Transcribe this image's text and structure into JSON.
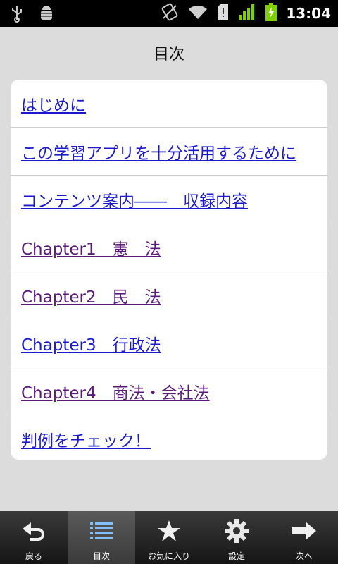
{
  "status_bar": {
    "time": "13:04",
    "icons_left": [
      "usb-icon",
      "android-debug-icon"
    ],
    "icons_right": [
      "no-sim-vibrate-icon",
      "wifi-icon",
      "sd-card-icon",
      "signal-icon",
      "battery-charging-icon"
    ]
  },
  "header": {
    "title": "目次"
  },
  "toc": {
    "items": [
      {
        "label": "はじめに",
        "visited": false
      },
      {
        "label": "この学習アプリを十分活用するために",
        "visited": false
      },
      {
        "label": "コンテンツ案内――　収録内容",
        "visited": false
      },
      {
        "label": "Chapter1　憲　法",
        "visited": true
      },
      {
        "label": "Chapter2　民　法",
        "visited": true
      },
      {
        "label": "Chapter3　行政法",
        "visited": false
      },
      {
        "label": "Chapter4　商法・会社法",
        "visited": true
      },
      {
        "label": "判例をチェック！",
        "visited": false
      }
    ]
  },
  "tabbar": {
    "tabs": [
      {
        "label": "戻る",
        "icon": "back-arrow-icon",
        "active": false
      },
      {
        "label": "目次",
        "icon": "list-icon",
        "active": true
      },
      {
        "label": "お気に入り",
        "icon": "star-icon",
        "active": false
      },
      {
        "label": "設定",
        "icon": "gear-icon",
        "active": false
      },
      {
        "label": "次へ",
        "icon": "forward-arrow-icon",
        "active": false
      }
    ]
  },
  "colors": {
    "link": "#1a1acc",
    "visited_link": "#5a1a7a",
    "background": "#dcdcdc",
    "battery": "#7fd000"
  }
}
